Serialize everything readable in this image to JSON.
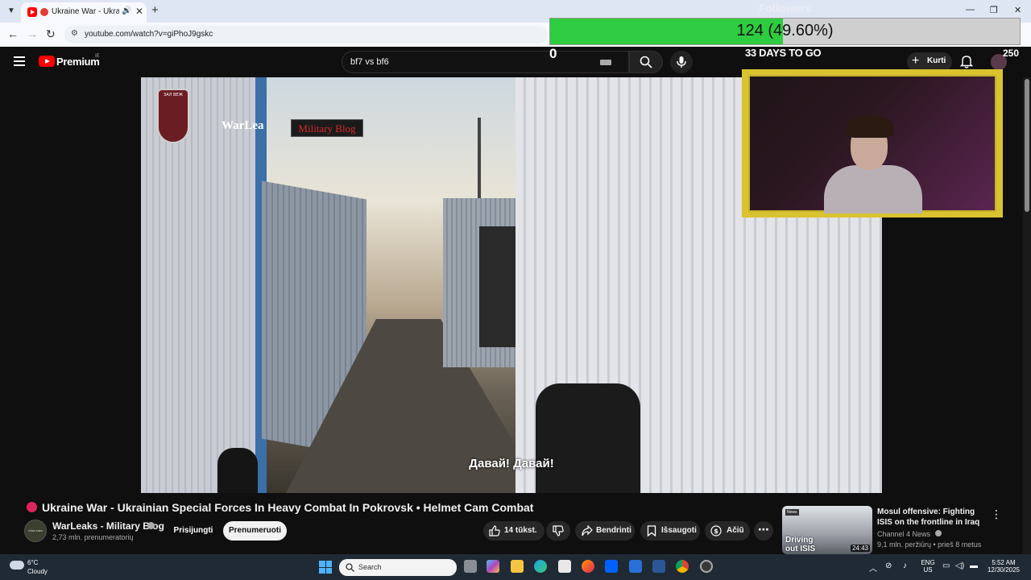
{
  "browser": {
    "tab_title": "Ukraine War - Ukrainian",
    "url": "youtube.com/watch?v=giPhoJ9gskc"
  },
  "youtube": {
    "brand": "Premium",
    "country": "IE",
    "search_value": "bf7 vs bf6",
    "create_label": "Kurti"
  },
  "overlay": {
    "followers_title": "Followers",
    "followers_count": "124 (49.60%)",
    "followers_progress": 0.496,
    "left_counter": "0",
    "days_label": "33 DAYS TO GO",
    "subs_count": "250"
  },
  "video": {
    "channel_watermark": "WarLea",
    "watermark_badge": "Military Blog",
    "logo_text": "ЗАЛ ВЕЖ",
    "subtitle": "Давай! Давай!",
    "title": "Ukraine War - Ukrainian Special Forces In Heavy Combat In Pokrovsk • Helmet Cam Combat",
    "channel_name": "WarLeaks - Military Blog",
    "channel_subs": "2,73 mln. prenumeratorių",
    "channel_avatar_text": "WarLeaks",
    "join_label": "Prisijungti",
    "subscribe_label": "Prenumeruoti",
    "like_count": "14 tūkst.",
    "share_label": "Bendrinti",
    "save_label": "Išsaugoti",
    "thanks_label": "Ačiū"
  },
  "recommendation": {
    "thumb_badge": "News",
    "thumb_text_1": "Driving",
    "thumb_text_2": "out ISIS",
    "duration": "24:43",
    "title": "Mosul offensive: Fighting ISIS on the frontline in Iraq",
    "channel": "Channel 4 News",
    "meta": "9,1 mln. peržiūrų • prieš 8 metus"
  },
  "taskbar": {
    "temperature": "6°C",
    "condition": "Cloudy",
    "search_placeholder": "Search",
    "lang_1": "ENG",
    "lang_2": "US",
    "time": "5:52 AM",
    "date": "12/30/2025"
  },
  "colors": {
    "youtube_red": "#ff0000",
    "followers_green": "#2ecc40",
    "webcam_frame": "#d9c32f",
    "taskbar_bg": "#1f2a35"
  }
}
